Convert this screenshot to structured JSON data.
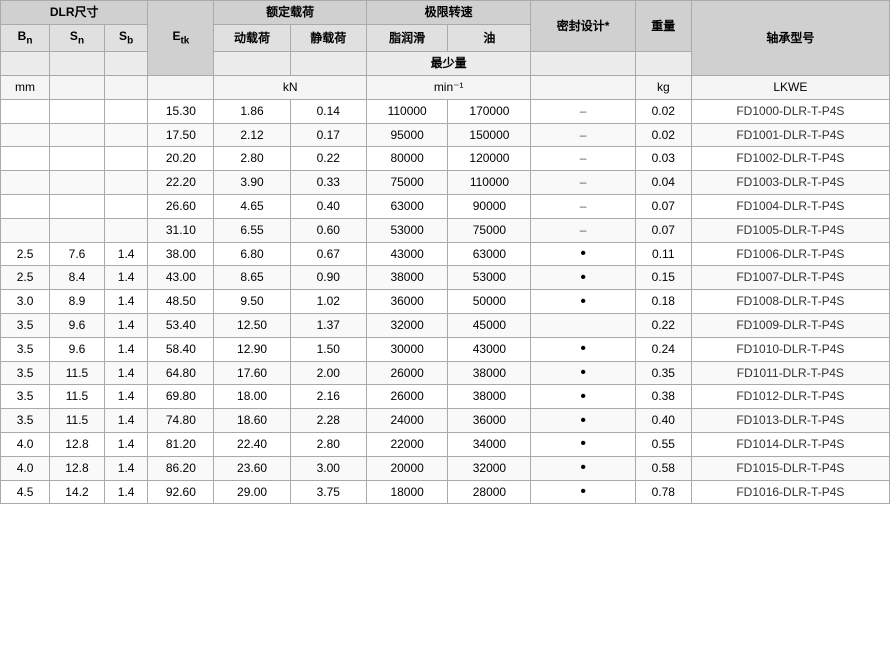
{
  "headers": {
    "dlr_size": "DLR尺寸",
    "rated_load": "额定载荷",
    "max_speed": "极限转速",
    "seal_design": "密封设计*",
    "weight": "重量",
    "bearing_number": "轴承型号",
    "bn": "B<sub>n</sub>",
    "sn": "S<sub>n</sub>",
    "sb": "S<sub>b</sub>",
    "etk": "E<sub>tk</sub>",
    "dynamic_load": "动载荷",
    "static_load": "静载荷",
    "grease": "脂润滑",
    "oil": "油",
    "min_amount": "最少量",
    "units_mm": "mm",
    "units_kn": "kN",
    "units_min": "min⁻¹",
    "units_kg": "kg",
    "units_lkwe": "LKWE"
  },
  "rows": [
    {
      "bn": "",
      "sn": "",
      "sb": "",
      "etk": "15.30",
      "dynamic": "1.86",
      "static": "0.14",
      "grease": "110000",
      "oil": "170000",
      "seal": "–",
      "weight": "0.02",
      "model": "FD1000-DLR-T-P4S"
    },
    {
      "bn": "",
      "sn": "",
      "sb": "",
      "etk": "17.50",
      "dynamic": "2.12",
      "static": "0.17",
      "grease": "95000",
      "oil": "150000",
      "seal": "–",
      "weight": "0.02",
      "model": "FD1001-DLR-T-P4S"
    },
    {
      "bn": "",
      "sn": "",
      "sb": "",
      "etk": "20.20",
      "dynamic": "2.80",
      "static": "0.22",
      "grease": "80000",
      "oil": "120000",
      "seal": "–",
      "weight": "0.03",
      "model": "FD1002-DLR-T-P4S"
    },
    {
      "bn": "",
      "sn": "",
      "sb": "",
      "etk": "22.20",
      "dynamic": "3.90",
      "static": "0.33",
      "grease": "75000",
      "oil": "110000",
      "seal": "–",
      "weight": "0.04",
      "model": "FD1003-DLR-T-P4S"
    },
    {
      "bn": "",
      "sn": "",
      "sb": "",
      "etk": "26.60",
      "dynamic": "4.65",
      "static": "0.40",
      "grease": "63000",
      "oil": "90000",
      "seal": "–",
      "weight": "0.07",
      "model": "FD1004-DLR-T-P4S"
    },
    {
      "bn": "",
      "sn": "",
      "sb": "",
      "etk": "31.10",
      "dynamic": "6.55",
      "static": "0.60",
      "grease": "53000",
      "oil": "75000",
      "seal": "–",
      "weight": "0.07",
      "model": "FD1005-DLR-T-P4S"
    },
    {
      "bn": "2.5",
      "sn": "7.6",
      "sb": "1.4",
      "etk": "38.00",
      "dynamic": "6.80",
      "static": "0.67",
      "grease": "43000",
      "oil": "63000",
      "seal": "•",
      "weight": "0.11",
      "model": "FD1006-DLR-T-P4S"
    },
    {
      "bn": "2.5",
      "sn": "8.4",
      "sb": "1.4",
      "etk": "43.00",
      "dynamic": "8.65",
      "static": "0.90",
      "grease": "38000",
      "oil": "53000",
      "seal": "•",
      "weight": "0.15",
      "model": "FD1007-DLR-T-P4S"
    },
    {
      "bn": "3.0",
      "sn": "8.9",
      "sb": "1.4",
      "etk": "48.50",
      "dynamic": "9.50",
      "static": "1.02",
      "grease": "36000",
      "oil": "50000",
      "seal": "•",
      "weight": "0.18",
      "model": "FD1008-DLR-T-P4S"
    },
    {
      "bn": "3.5",
      "sn": "9.6",
      "sb": "1.4",
      "etk": "53.40",
      "dynamic": "12.50",
      "static": "1.37",
      "grease": "32000",
      "oil": "45000",
      "seal": "",
      "weight": "0.22",
      "model": "FD1009-DLR-T-P4S"
    },
    {
      "bn": "3.5",
      "sn": "9.6",
      "sb": "1.4",
      "etk": "58.40",
      "dynamic": "12.90",
      "static": "1.50",
      "grease": "30000",
      "oil": "43000",
      "seal": "•",
      "weight": "0.24",
      "model": "FD1010-DLR-T-P4S"
    },
    {
      "bn": "3.5",
      "sn": "11.5",
      "sb": "1.4",
      "etk": "64.80",
      "dynamic": "17.60",
      "static": "2.00",
      "grease": "26000",
      "oil": "38000",
      "seal": "•",
      "weight": "0.35",
      "model": "FD1011-DLR-T-P4S"
    },
    {
      "bn": "3.5",
      "sn": "11.5",
      "sb": "1.4",
      "etk": "69.80",
      "dynamic": "18.00",
      "static": "2.16",
      "grease": "26000",
      "oil": "38000",
      "seal": "•",
      "weight": "0.38",
      "model": "FD1012-DLR-T-P4S"
    },
    {
      "bn": "3.5",
      "sn": "11.5",
      "sb": "1.4",
      "etk": "74.80",
      "dynamic": "18.60",
      "static": "2.28",
      "grease": "24000",
      "oil": "36000",
      "seal": "•",
      "weight": "0.40",
      "model": "FD1013-DLR-T-P4S"
    },
    {
      "bn": "4.0",
      "sn": "12.8",
      "sb": "1.4",
      "etk": "81.20",
      "dynamic": "22.40",
      "static": "2.80",
      "grease": "22000",
      "oil": "34000",
      "seal": "•",
      "weight": "0.55",
      "model": "FD1014-DLR-T-P4S"
    },
    {
      "bn": "4.0",
      "sn": "12.8",
      "sb": "1.4",
      "etk": "86.20",
      "dynamic": "23.60",
      "static": "3.00",
      "grease": "20000",
      "oil": "32000",
      "seal": "•",
      "weight": "0.58",
      "model": "FD1015-DLR-T-P4S"
    },
    {
      "bn": "4.5",
      "sn": "14.2",
      "sb": "1.4",
      "etk": "92.60",
      "dynamic": "29.00",
      "static": "3.75",
      "grease": "18000",
      "oil": "28000",
      "seal": "•",
      "weight": "0.78",
      "model": "FD1016-DLR-T-P4S"
    }
  ]
}
